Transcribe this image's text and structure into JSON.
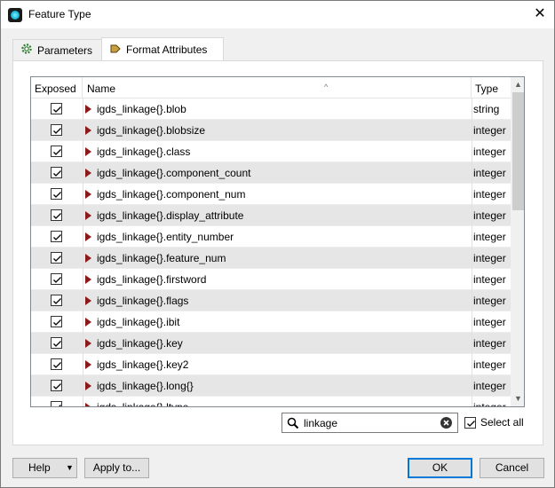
{
  "window": {
    "title": "Feature Type",
    "close_label": "✕"
  },
  "tabs": [
    {
      "label": "Parameters",
      "icon": "gear-icon",
      "active": false
    },
    {
      "label": "Format Attributes",
      "icon": "arrow-right-icon",
      "active": true
    }
  ],
  "table": {
    "columns": {
      "exposed": "Exposed",
      "name": "Name",
      "type": "Type"
    },
    "rows": [
      {
        "exposed": true,
        "name": "igds_linkage{}.blob",
        "type": "string"
      },
      {
        "exposed": true,
        "name": "igds_linkage{}.blobsize",
        "type": "integer"
      },
      {
        "exposed": true,
        "name": "igds_linkage{}.class",
        "type": "integer"
      },
      {
        "exposed": true,
        "name": "igds_linkage{}.component_count",
        "type": "integer"
      },
      {
        "exposed": true,
        "name": "igds_linkage{}.component_num",
        "type": "integer"
      },
      {
        "exposed": true,
        "name": "igds_linkage{}.display_attribute",
        "type": "integer"
      },
      {
        "exposed": true,
        "name": "igds_linkage{}.entity_number",
        "type": "integer"
      },
      {
        "exposed": true,
        "name": "igds_linkage{}.feature_num",
        "type": "integer"
      },
      {
        "exposed": true,
        "name": "igds_linkage{}.firstword",
        "type": "integer"
      },
      {
        "exposed": true,
        "name": "igds_linkage{}.flags",
        "type": "integer"
      },
      {
        "exposed": true,
        "name": "igds_linkage{}.ibit",
        "type": "integer"
      },
      {
        "exposed": true,
        "name": "igds_linkage{}.key",
        "type": "integer"
      },
      {
        "exposed": true,
        "name": "igds_linkage{}.key2",
        "type": "integer"
      },
      {
        "exposed": true,
        "name": "igds_linkage{}.long{}",
        "type": "integer"
      },
      {
        "exposed": true,
        "name": "igds_linkage{}.ltype",
        "type": "integer"
      }
    ]
  },
  "search": {
    "value": "linkage"
  },
  "select_all": {
    "label": "Select all",
    "checked": true
  },
  "buttons": {
    "help": "Help",
    "apply": "Apply to...",
    "ok": "OK",
    "cancel": "Cancel"
  }
}
